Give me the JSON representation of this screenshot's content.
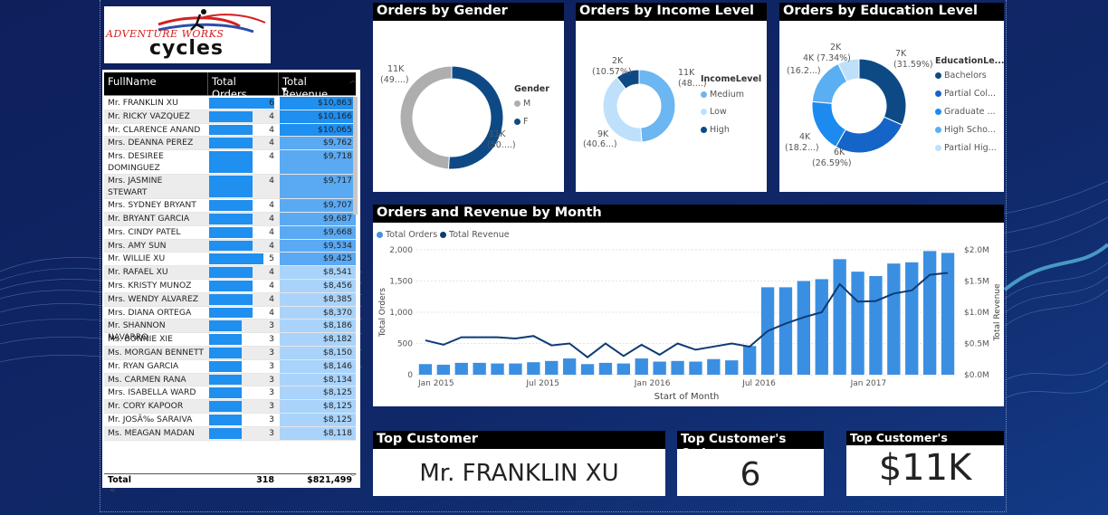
{
  "logo": {
    "line1": "ADVENTURE WORKS",
    "line2": "cycles"
  },
  "table": {
    "headers": {
      "name": "FullName",
      "orders": "Total Orders",
      "revenue": "Total Revenue"
    },
    "max_orders": 6,
    "max_revenue": 10863,
    "rows": [
      {
        "name": "Mr. FRANKLIN XU",
        "orders": 6,
        "revenue": "$10,863",
        "rev": 10863
      },
      {
        "name": "Mr. RICKY VAZQUEZ",
        "orders": 4,
        "revenue": "$10,166",
        "rev": 10166
      },
      {
        "name": "Mr. CLARENCE ANAND",
        "orders": 4,
        "revenue": "$10,065",
        "rev": 10065
      },
      {
        "name": "Mrs. DEANNA PEREZ",
        "orders": 4,
        "revenue": "$9,762",
        "rev": 9762
      },
      {
        "name": "Mrs. DESIREE DOMINGUEZ",
        "orders": 4,
        "revenue": "$9,718",
        "rev": 9718
      },
      {
        "name": "Mrs. JASMINE STEWART",
        "orders": 4,
        "revenue": "$9,717",
        "rev": 9717
      },
      {
        "name": "Mrs. SYDNEY BRYANT",
        "orders": 4,
        "revenue": "$9,707",
        "rev": 9707
      },
      {
        "name": "Mr. BRYANT GARCIA",
        "orders": 4,
        "revenue": "$9,687",
        "rev": 9687
      },
      {
        "name": "Mrs. CINDY PATEL",
        "orders": 4,
        "revenue": "$9,668",
        "rev": 9668
      },
      {
        "name": "Mrs. AMY SUN",
        "orders": 4,
        "revenue": "$9,534",
        "rev": 9534
      },
      {
        "name": "Mr. WILLIE XU",
        "orders": 5,
        "revenue": "$9,425",
        "rev": 9425
      },
      {
        "name": "Mr. RAFAEL XU",
        "orders": 4,
        "revenue": "$8,541",
        "rev": 8541
      },
      {
        "name": "Mrs. KRISTY MUNOZ",
        "orders": 4,
        "revenue": "$8,456",
        "rev": 8456
      },
      {
        "name": "Mrs. WENDY ALVAREZ",
        "orders": 4,
        "revenue": "$8,385",
        "rev": 8385
      },
      {
        "name": "Mrs. DIANA ORTEGA",
        "orders": 4,
        "revenue": "$8,370",
        "rev": 8370
      },
      {
        "name": "Mr. SHANNON NAVARRO",
        "orders": 3,
        "revenue": "$8,186",
        "rev": 8186
      },
      {
        "name": "Ms. BONNIE XIE",
        "orders": 3,
        "revenue": "$8,182",
        "rev": 8182
      },
      {
        "name": "Ms. MORGAN BENNETT",
        "orders": 3,
        "revenue": "$8,150",
        "rev": 8150
      },
      {
        "name": "Mr. RYAN GARCIA",
        "orders": 3,
        "revenue": "$8,146",
        "rev": 8146
      },
      {
        "name": "Ms. CARMEN RANA",
        "orders": 3,
        "revenue": "$8,134",
        "rev": 8134
      },
      {
        "name": "Mrs. ISABELLA WARD",
        "orders": 3,
        "revenue": "$8,125",
        "rev": 8125
      },
      {
        "name": "Mr. CORY KAPOOR",
        "orders": 3,
        "revenue": "$8,125",
        "rev": 8125
      },
      {
        "name": "Mr. JOSÃ‰ SARAIVA",
        "orders": 3,
        "revenue": "$8,125",
        "rev": 8125
      },
      {
        "name": "Ms. MEAGAN MADAN",
        "orders": 3,
        "revenue": "$8,118",
        "rev": 8118
      }
    ],
    "footer": {
      "label": "Total",
      "orders": "318",
      "revenue": "$821,499"
    }
  },
  "gender": {
    "title": "Orders by Gender",
    "legend_title": "Gender",
    "slices": [
      {
        "name": "M",
        "value": 49,
        "label1": "11K",
        "label2": "(49....)",
        "color": "#aeaeae"
      },
      {
        "name": "F",
        "value": 51,
        "label1": "11K",
        "label2": "(50....)",
        "color": "#0d4a85"
      }
    ]
  },
  "income": {
    "title": "Orders by Income Level",
    "legend_title": "IncomeLevel",
    "slices": [
      {
        "name": "Medium",
        "value": 48.8,
        "label1": "11K",
        "label2": "(48....)",
        "color": "#6cb6f2"
      },
      {
        "name": "Low",
        "value": 40.6,
        "label1": "9K",
        "label2": "(40.6...)",
        "color": "#bfe0fb"
      },
      {
        "name": "High",
        "value": 10.57,
        "label1": "2K",
        "label2": "(10.57%)",
        "color": "#0d4a85"
      }
    ]
  },
  "education": {
    "title": "Orders by Education Level",
    "legend_title": "EducationLe...",
    "slices": [
      {
        "name": "Bachelors",
        "value": 31.59,
        "label1": "7K",
        "label2": "(31.59%)",
        "color": "#0d4a85"
      },
      {
        "name": "Partial Col...",
        "value": 26.59,
        "label1": "6K",
        "label2": "(26.59%)",
        "color": "#1565c8"
      },
      {
        "name": "Graduate ...",
        "value": 18.2,
        "label1": "4K",
        "label2": "(18.2...)",
        "color": "#1d8af0"
      },
      {
        "name": "High Scho...",
        "value": 16.2,
        "label1": "4K",
        "label2": "(16.2...)",
        "color": "#59aff2"
      },
      {
        "name": "Partial Hig...",
        "value": 7.34,
        "label1": "2K",
        "label2": "",
        "color": "#bfe0fb"
      }
    ],
    "extra_label": "4K (7.34%)",
    "extra_label_a": "2K",
    "extra_label_b": "4K (7.34%)"
  },
  "month_chart": {
    "title": "Orders and Revenue by Month",
    "legend": [
      {
        "name": "Total Orders",
        "color": "#4a90e2"
      },
      {
        "name": "Total Revenue",
        "color": "#0d3b73"
      }
    ],
    "xlabel": "Start of Month",
    "ylabel_left": "Total Orders",
    "ylabel_right": "Total Revenue",
    "x_ticks": [
      "Jan 2015",
      "Jul 2015",
      "Jan 2016",
      "Jul 2016",
      "Jan 2017"
    ],
    "y_left_ticks": [
      "0",
      "500",
      "1,000",
      "1,500",
      "2,000"
    ],
    "y_right_ticks": [
      "$0.0M",
      "$0.5M",
      "$1.0M",
      "$1.5M",
      "$2.0M"
    ]
  },
  "chart_data": {
    "type": "bar",
    "x": [
      "2015-01",
      "2015-02",
      "2015-03",
      "2015-04",
      "2015-05",
      "2015-06",
      "2015-07",
      "2015-08",
      "2015-09",
      "2015-10",
      "2015-11",
      "2015-12",
      "2016-01",
      "2016-02",
      "2016-03",
      "2016-04",
      "2016-05",
      "2016-06",
      "2016-07",
      "2016-08",
      "2016-09",
      "2016-10",
      "2016-11",
      "2016-12",
      "2017-01",
      "2017-02",
      "2017-03",
      "2017-04",
      "2017-05",
      "2017-06"
    ],
    "series": [
      {
        "name": "Total Orders",
        "type": "bar",
        "axis": "left",
        "values": [
          170,
          160,
          190,
          190,
          180,
          180,
          200,
          220,
          260,
          170,
          190,
          180,
          260,
          210,
          220,
          210,
          250,
          230,
          460,
          1400,
          1400,
          1500,
          1530,
          1850,
          1650,
          1580,
          1780,
          1800,
          1980,
          1950
        ]
      },
      {
        "name": "Total Revenue",
        "type": "line",
        "axis": "right",
        "values": [
          0.55,
          0.48,
          0.6,
          0.6,
          0.6,
          0.58,
          0.62,
          0.47,
          0.5,
          0.28,
          0.5,
          0.3,
          0.48,
          0.32,
          0.5,
          0.4,
          0.45,
          0.5,
          0.45,
          0.7,
          0.82,
          0.92,
          1.0,
          1.45,
          1.17,
          1.18,
          1.3,
          1.35,
          1.6,
          1.63
        ]
      }
    ],
    "ylim_left": [
      0,
      2000
    ],
    "ylim_right": [
      0,
      2.0
    ],
    "xlabel": "Start of Month",
    "ylabel": "Total Orders"
  },
  "kpi": {
    "top_customer": {
      "title": "Top Customer",
      "value": "Mr. FRANKLIN XU"
    },
    "top_orders": {
      "title": "Top Customer's Orders",
      "value": "6"
    },
    "top_revenue": {
      "title": "Top Customer's Revenue",
      "value": "$11K"
    }
  }
}
